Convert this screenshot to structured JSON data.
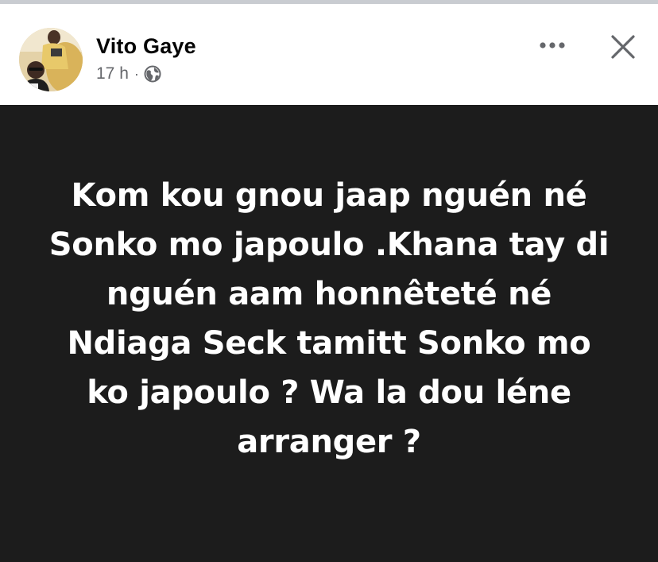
{
  "post": {
    "author": "Vito Gaye",
    "timestamp": "17 h",
    "separator": "·",
    "audience_icon": "globe-icon",
    "more_icon": "more-horizontal-icon",
    "close_icon": "close-icon",
    "text": "Kom kou gnou jaap nguén né Sonko mo japoulo .Khana tay di nguén aam honnêteté né Ndiaga Seck tamitt Sonko mo ko japoulo ? Wa la dou léne arranger ?"
  },
  "colors": {
    "post_background": "#1c1c1c",
    "post_text": "#ffffff",
    "author_text": "#050505",
    "meta_text": "#65676b"
  }
}
